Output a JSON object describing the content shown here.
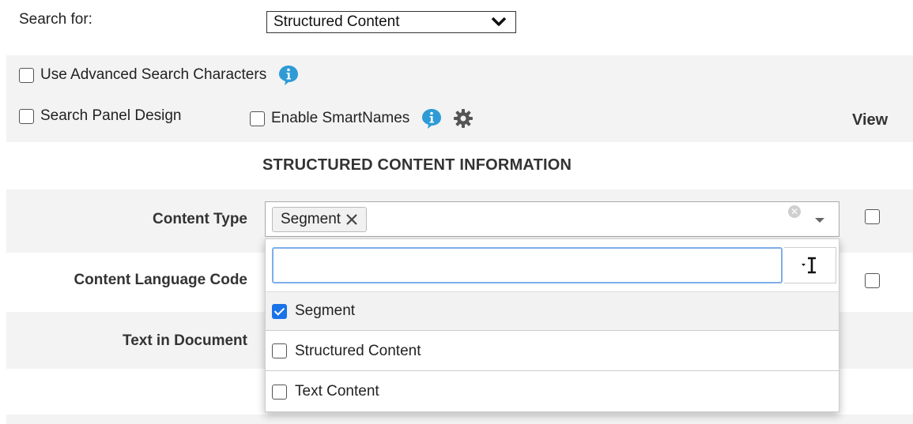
{
  "search_for": {
    "label": "Search for:",
    "selected": "Structured Content"
  },
  "options": {
    "advanced_chars": "Use Advanced Search Characters",
    "panel_design": "Search Panel Design",
    "smartnames": "Enable SmartNames",
    "view_label": "View"
  },
  "section": {
    "title": "STRUCTURED CONTENT INFORMATION"
  },
  "fields": {
    "content_type": {
      "label": "Content Type",
      "tag": "Segment",
      "tag_remove": "✕",
      "clear": "✕"
    },
    "content_language_code": {
      "label": "Content Language Code"
    },
    "text_in_document": {
      "label": "Text in Document"
    }
  },
  "dropdown": {
    "search_value": "",
    "tool_glyph": "▾I",
    "items": [
      {
        "label": "Segment",
        "checked": true
      },
      {
        "label": "Structured Content",
        "checked": false
      },
      {
        "label": "Text Content",
        "checked": false
      }
    ]
  },
  "colors": {
    "accent": "#1a73e8",
    "info_icon": "#2e9bd6",
    "gear_icon": "#555555",
    "band": "#f3f3f3"
  },
  "icons": [
    "info-icon",
    "gear-icon",
    "chevron-down-icon",
    "close-icon",
    "caret-down-icon",
    "text-cursor-icon"
  ]
}
